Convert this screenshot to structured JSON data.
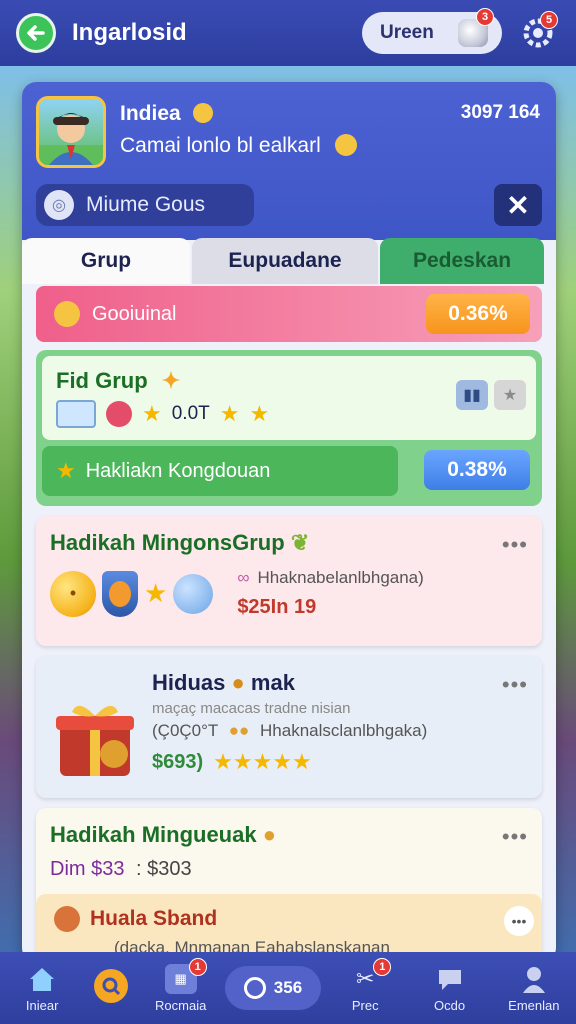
{
  "header": {
    "title": "Ingarlosid",
    "pill_label": "Ureen",
    "pill_badge": "3",
    "settings_badge": "5"
  },
  "profile": {
    "name": "Indiea",
    "stat": "3097 164",
    "subtitle": "Camai lonlo bl ealkarl",
    "search_label": "Miume Gous"
  },
  "tabs": [
    {
      "label": "Grup"
    },
    {
      "label": "Eupuadane"
    },
    {
      "label": "Pedeskan"
    }
  ],
  "rank": {
    "label": "Gooiuinal",
    "percent": "0.36%"
  },
  "group": {
    "title": "Fid Grup",
    "value": "0.0T",
    "bottom_label": "Hakliakn Kongdouan",
    "percent": "0.38%"
  },
  "cards": [
    {
      "title": "Hadikah MingonsGrup",
      "desc": "Hhaknabelanlbhgana)",
      "price": "$25In 19"
    },
    {
      "title": "Hiduas",
      "title_suffix": "mak",
      "line1": "maçaç macacas tradne nisian",
      "line2_code": "(Ç0Ç0°T",
      "line2_desc": "Hhaknalsclanlbhgaka)",
      "price": "$693)"
    },
    {
      "title": "Hadikah Mingueuak",
      "price_label": "Dim $33",
      "price_value": ": $303"
    }
  ],
  "sub_card": {
    "title": "Huala Sband",
    "desc": "(dacka, Mnmanan Eahabslanskanan"
  },
  "nav": [
    {
      "label": "Iniear",
      "icon": "home-icon"
    },
    {
      "label": "",
      "icon": "search-icon"
    },
    {
      "label": "Rocmaia",
      "icon": "grid-icon",
      "badge": "1"
    },
    {
      "label": "356",
      "icon": "circle-icon"
    },
    {
      "label": "Prec",
      "icon": "tools-icon",
      "badge": "1"
    },
    {
      "label": "Ocdo",
      "icon": "chat-icon"
    },
    {
      "label": "Emenlan",
      "icon": "person-icon"
    }
  ],
  "colors": {
    "header": "#2d3e9f",
    "accent_green": "#3cc45a",
    "rank_pink": "#ef5f8a",
    "chip_orange": "#f7941d",
    "chip_blue": "#3e7ee6"
  }
}
